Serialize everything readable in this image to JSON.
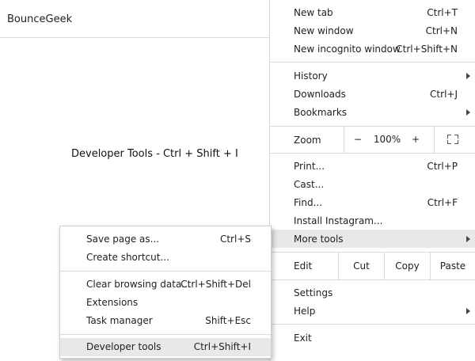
{
  "page": {
    "site_title": "BounceGeek",
    "caption": "Developer Tools - Ctrl + Shift + I"
  },
  "menu": {
    "new_tab": {
      "label": "New tab",
      "shortcut": "Ctrl+T"
    },
    "new_window": {
      "label": "New window",
      "shortcut": "Ctrl+N"
    },
    "new_incognito": {
      "label": "New incognito window",
      "shortcut": "Ctrl+Shift+N"
    },
    "history": {
      "label": "History"
    },
    "downloads": {
      "label": "Downloads",
      "shortcut": "Ctrl+J"
    },
    "bookmarks": {
      "label": "Bookmarks"
    },
    "zoom": {
      "label": "Zoom",
      "minus": "−",
      "level": "100%",
      "plus": "+"
    },
    "print": {
      "label": "Print...",
      "shortcut": "Ctrl+P"
    },
    "cast": {
      "label": "Cast..."
    },
    "find": {
      "label": "Find...",
      "shortcut": "Ctrl+F"
    },
    "install": {
      "label": "Install Instagram..."
    },
    "more_tools": {
      "label": "More tools"
    },
    "edit": {
      "label": "Edit",
      "cut": "Cut",
      "copy": "Copy",
      "paste": "Paste"
    },
    "settings": {
      "label": "Settings"
    },
    "help": {
      "label": "Help"
    },
    "exit": {
      "label": "Exit"
    }
  },
  "submenu": {
    "save_page": {
      "label": "Save page as...",
      "shortcut": "Ctrl+S"
    },
    "create_shortcut": {
      "label": "Create shortcut..."
    },
    "clear_data": {
      "label": "Clear browsing data...",
      "shortcut": "Ctrl+Shift+Del"
    },
    "extensions": {
      "label": "Extensions"
    },
    "task_manager": {
      "label": "Task manager",
      "shortcut": "Shift+Esc"
    },
    "developer_tools": {
      "label": "Developer tools",
      "shortcut": "Ctrl+Shift+I"
    }
  },
  "colors": {
    "highlight": "#e8e8e8",
    "separator": "#dadada"
  }
}
